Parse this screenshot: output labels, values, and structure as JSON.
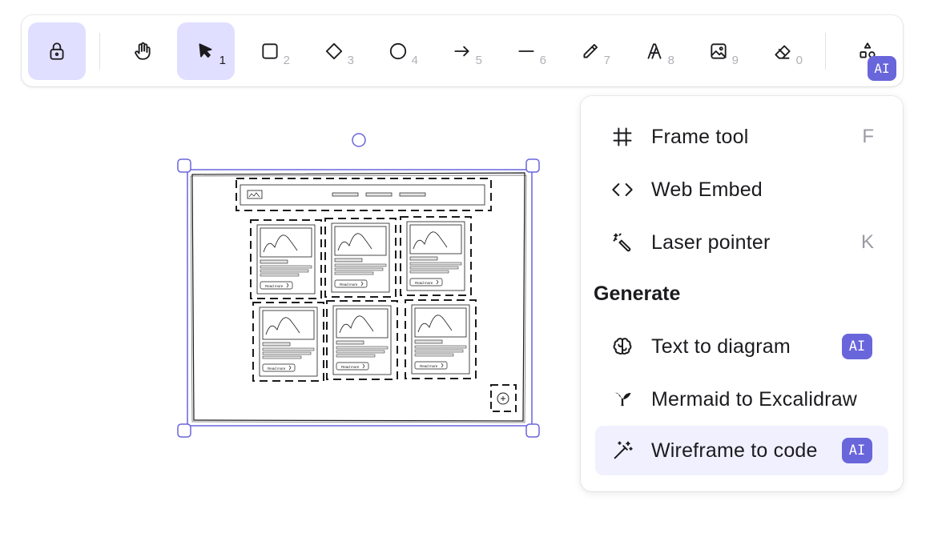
{
  "toolbar": {
    "tools": [
      {
        "name": "lock",
        "key": ""
      },
      {
        "name": "hand",
        "key": ""
      },
      {
        "name": "selection",
        "key": "1"
      },
      {
        "name": "rectangle",
        "key": "2"
      },
      {
        "name": "diamond",
        "key": "3"
      },
      {
        "name": "ellipse",
        "key": "4"
      },
      {
        "name": "arrow",
        "key": "5"
      },
      {
        "name": "line",
        "key": "6"
      },
      {
        "name": "draw",
        "key": "7"
      },
      {
        "name": "text",
        "key": "8"
      },
      {
        "name": "image",
        "key": "9"
      },
      {
        "name": "eraser",
        "key": "0"
      },
      {
        "name": "more-tools",
        "key": ""
      }
    ],
    "more_badge": "AI"
  },
  "menu": {
    "items": [
      {
        "label": "Frame tool",
        "shortcut": "F"
      },
      {
        "label": "Web Embed",
        "shortcut": ""
      },
      {
        "label": "Laser pointer",
        "shortcut": "K"
      }
    ],
    "generate_title": "Generate",
    "generate_items": [
      {
        "label": "Text to diagram",
        "badge": "AI"
      },
      {
        "label": "Mermaid to Excalidraw",
        "badge": ""
      },
      {
        "label": "Wireframe to code",
        "badge": "AI"
      }
    ]
  },
  "wireframe": {
    "card_button": "Read more"
  },
  "colors": {
    "accent": "#6965db",
    "active_bg": "#e0dfff",
    "hover_bg": "#f1f0ff"
  }
}
